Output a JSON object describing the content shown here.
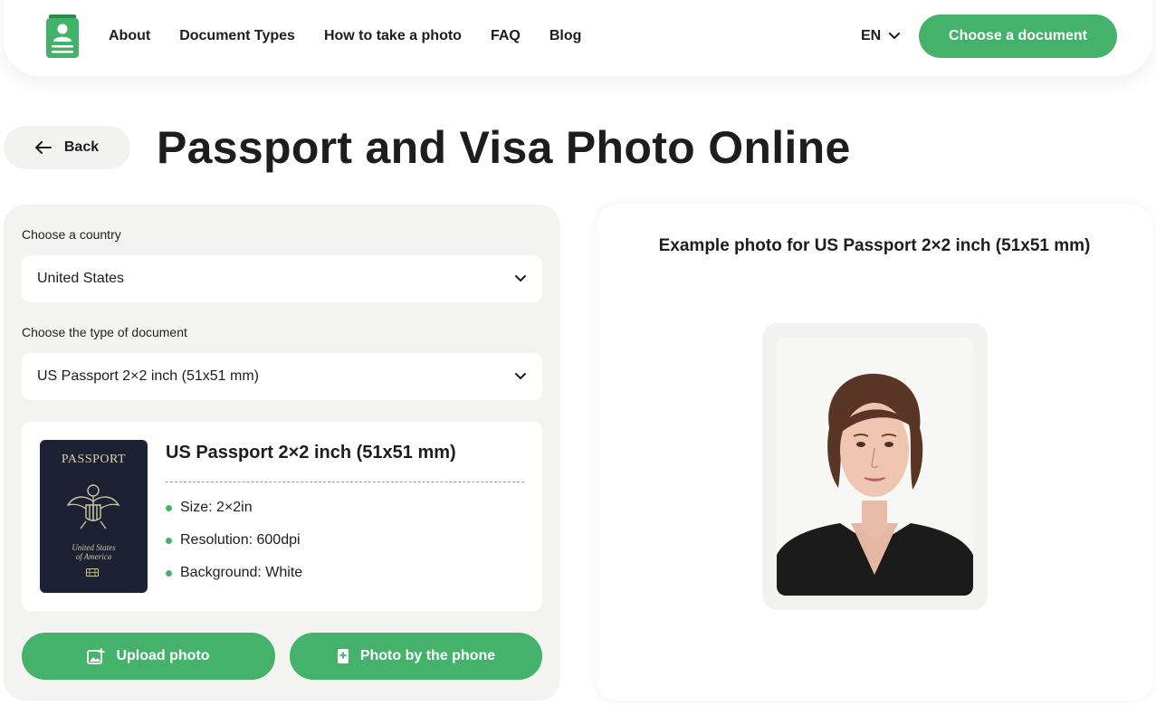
{
  "header": {
    "nav": [
      "About",
      "Document Types",
      "How to take a photo",
      "FAQ",
      "Blog"
    ],
    "language": "EN",
    "cta_label": "Choose a document"
  },
  "page": {
    "back_label": "Back",
    "title": "Passport and Visa Photo Online"
  },
  "form": {
    "country_label": "Choose a country",
    "country_value": "United States",
    "doc_type_label": "Choose the type of document",
    "doc_type_value": "US Passport 2×2 inch (51x51 mm)"
  },
  "document": {
    "title": "US Passport 2×2 inch (51x51 mm)",
    "cover_title": "PASSPORT",
    "cover_subtitle_1": "United States",
    "cover_subtitle_2": "of America",
    "specs": [
      "Size: 2×2in",
      "Resolution: 600dpi",
      "Background: White"
    ]
  },
  "actions": {
    "upload_label": "Upload photo",
    "phone_label": "Photo by the phone"
  },
  "example": {
    "title": "Example photo for US Passport 2×2 inch (51x51 mm)"
  },
  "colors": {
    "accent": "#45b26b",
    "panel": "#f3f4f2",
    "passport_cover": "#1c2233"
  },
  "icons": [
    "id-card-logo-icon",
    "chevron-down-icon",
    "arrow-left-icon",
    "image-upload-icon",
    "phone-icon",
    "eagle-seal-icon",
    "chip-icon",
    "bullet-dot-icon"
  ]
}
